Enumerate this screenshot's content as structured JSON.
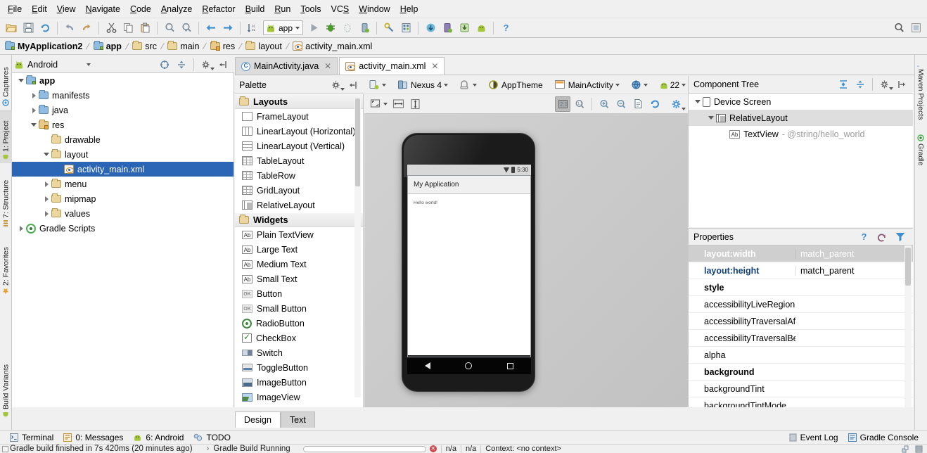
{
  "menu": {
    "items": [
      {
        "label": "File",
        "accel": "F"
      },
      {
        "label": "Edit",
        "accel": "E"
      },
      {
        "label": "View",
        "accel": "V"
      },
      {
        "label": "Navigate",
        "accel": "N"
      },
      {
        "label": "Code",
        "accel": "C"
      },
      {
        "label": "Analyze",
        "accel": "A"
      },
      {
        "label": "Refactor",
        "accel": "R"
      },
      {
        "label": "Build",
        "accel": "B"
      },
      {
        "label": "Run",
        "accel": "R"
      },
      {
        "label": "Tools",
        "accel": "T"
      },
      {
        "label": "VCS",
        "accel": "S"
      },
      {
        "label": "Window",
        "accel": "W"
      },
      {
        "label": "Help",
        "accel": "H"
      }
    ]
  },
  "toolbar": {
    "run_config": "app",
    "icons": [
      "open-folder-icon",
      "save-all-icon",
      "sync-icon",
      "undo-icon",
      "redo-icon",
      "cut-icon",
      "copy-icon",
      "paste-icon",
      "find-icon",
      "replace-icon",
      "back-icon",
      "forward-icon",
      "sort-icon"
    ],
    "right_icons": [
      "search-everywhere-icon",
      "layout-toggle-icon"
    ]
  },
  "breadcrumb": {
    "items": [
      {
        "label": "MyApplication2",
        "icon": "project-icon",
        "bold": true
      },
      {
        "label": "app",
        "icon": "module-icon",
        "bold": true
      },
      {
        "label": "src",
        "icon": "folder-icon",
        "bold": false
      },
      {
        "label": "main",
        "icon": "folder-icon",
        "bold": false
      },
      {
        "label": "res",
        "icon": "res-folder-icon",
        "bold": false
      },
      {
        "label": "layout",
        "icon": "folder-icon",
        "bold": false
      },
      {
        "label": "activity_main.xml",
        "icon": "xml-layout-icon",
        "bold": false
      }
    ]
  },
  "left_strip": {
    "tabs": [
      {
        "label": "Captures",
        "icon": "captures-icon"
      },
      {
        "label": "1: Project",
        "icon": "project-icon",
        "selected": true
      },
      {
        "label": "7: Structure",
        "icon": "structure-icon"
      },
      {
        "label": "2: Favorites",
        "icon": "favorites-icon"
      },
      {
        "label": "Build Variants",
        "icon": "build-variants-icon"
      }
    ]
  },
  "right_strip": {
    "tabs": [
      {
        "label": "Maven Projects",
        "icon": "maven-icon"
      },
      {
        "label": "Gradle",
        "icon": "gradle-icon"
      }
    ]
  },
  "project": {
    "view_selector": "Android",
    "tools": [
      "target-icon",
      "collapse-all-icon",
      "settings-icon",
      "hide-icon"
    ],
    "tree": [
      {
        "label": "app",
        "depth": 0,
        "twisty": "down",
        "icon": "module-folder-icon",
        "bold": true,
        "selected": false
      },
      {
        "label": "manifests",
        "depth": 1,
        "twisty": "right",
        "icon": "folder-icon",
        "bold": false,
        "selected": false
      },
      {
        "label": "java",
        "depth": 1,
        "twisty": "right",
        "icon": "folder-icon",
        "bold": false,
        "selected": false
      },
      {
        "label": "res",
        "depth": 1,
        "twisty": "down",
        "icon": "res-folder-icon",
        "bold": false,
        "selected": false
      },
      {
        "label": "drawable",
        "depth": 2,
        "twisty": "none",
        "icon": "tan-folder-icon",
        "bold": false,
        "selected": false
      },
      {
        "label": "layout",
        "depth": 2,
        "twisty": "down",
        "icon": "tan-folder-icon",
        "bold": false,
        "selected": false
      },
      {
        "label": "activity_main.xml",
        "depth": 3,
        "twisty": "none",
        "icon": "xml-layout-icon",
        "bold": false,
        "selected": true
      },
      {
        "label": "menu",
        "depth": 2,
        "twisty": "right",
        "icon": "tan-folder-icon",
        "bold": false,
        "selected": false
      },
      {
        "label": "mipmap",
        "depth": 2,
        "twisty": "right",
        "icon": "tan-folder-icon",
        "bold": false,
        "selected": false
      },
      {
        "label": "values",
        "depth": 2,
        "twisty": "right",
        "icon": "tan-folder-icon",
        "bold": false,
        "selected": false
      },
      {
        "label": "Gradle Scripts",
        "depth": 0,
        "twisty": "right",
        "icon": "gradle-icon",
        "bold": false,
        "selected": false
      }
    ]
  },
  "palette": {
    "title": "Palette",
    "tools": [
      "settings-icon",
      "hide-icon"
    ],
    "groups": [
      {
        "name": "Layouts",
        "items": [
          {
            "label": "FrameLayout",
            "icon": "frame-layout-icon"
          },
          {
            "label": "LinearLayout (Horizontal)",
            "icon": "linear-layout-horizontal-icon"
          },
          {
            "label": "LinearLayout (Vertical)",
            "icon": "linear-layout-vertical-icon"
          },
          {
            "label": "TableLayout",
            "icon": "table-layout-icon"
          },
          {
            "label": "TableRow",
            "icon": "table-row-icon"
          },
          {
            "label": "GridLayout",
            "icon": "grid-layout-icon"
          },
          {
            "label": "RelativeLayout",
            "icon": "relative-layout-icon"
          }
        ]
      },
      {
        "name": "Widgets",
        "items": [
          {
            "label": "Plain TextView",
            "icon": "textview-icon"
          },
          {
            "label": "Large Text",
            "icon": "textview-icon"
          },
          {
            "label": "Medium Text",
            "icon": "textview-icon"
          },
          {
            "label": "Small Text",
            "icon": "textview-icon"
          },
          {
            "label": "Button",
            "icon": "button-icon"
          },
          {
            "label": "Small Button",
            "icon": "button-icon"
          },
          {
            "label": "RadioButton",
            "icon": "radiobutton-icon"
          },
          {
            "label": "CheckBox",
            "icon": "checkbox-icon"
          },
          {
            "label": "Switch",
            "icon": "switch-icon"
          },
          {
            "label": "ToggleButton",
            "icon": "togglebutton-icon"
          },
          {
            "label": "ImageButton",
            "icon": "imagebutton-icon"
          },
          {
            "label": "ImageView",
            "icon": "imageview-icon"
          }
        ]
      }
    ]
  },
  "editor": {
    "tabs": [
      {
        "label": "MainActivity.java",
        "icon": "java-class-icon",
        "active": false
      },
      {
        "label": "activity_main.xml",
        "icon": "xml-layout-icon",
        "active": true
      }
    ],
    "toolbar": {
      "device_config": "device-config-icon",
      "device": "Nexus 4",
      "orientation": "orientation-icon",
      "theme": "AppTheme",
      "activity": "MainActivity",
      "locale": "locale-globe-icon",
      "api_level": "22"
    },
    "toolbar2": {
      "icons": [
        "fit-to-screen-icon",
        "width-icon",
        "height-icon",
        "zoom-actual-icon",
        "zoom-fit-icon",
        "zoom-in-icon",
        "zoom-out-icon",
        "preview-icon",
        "refresh-icon",
        "settings-icon"
      ]
    },
    "bottom_tabs": [
      {
        "label": "Design",
        "active": true
      },
      {
        "label": "Text",
        "active": false
      }
    ]
  },
  "preview": {
    "status_time": "5:30",
    "app_title": "My Application",
    "body_text": "Hello world!",
    "nav_buttons": [
      "back-icon",
      "home-icon",
      "recents-icon"
    ]
  },
  "component_tree": {
    "title": "Component Tree",
    "tools": [
      "expand-all-icon",
      "collapse-all-icon",
      "settings-icon",
      "hide-icon"
    ],
    "nodes": [
      {
        "label": "Device Screen",
        "detail": "",
        "depth": 0,
        "twisty": "down",
        "icon": "device-screen-icon",
        "highlight": false
      },
      {
        "label": "RelativeLayout",
        "detail": "",
        "depth": 1,
        "twisty": "down",
        "icon": "relative-layout-icon",
        "highlight": true
      },
      {
        "label": "TextView",
        "detail": "- @string/hello_world",
        "depth": 2,
        "twisty": "none",
        "icon": "textview-icon",
        "highlight": false
      }
    ]
  },
  "properties": {
    "title": "Properties",
    "tools": [
      "help-icon",
      "restore-icon",
      "filter-icon"
    ],
    "rows": [
      {
        "key": "layout:width",
        "value": "match_parent",
        "style": "selected"
      },
      {
        "key": "layout:height",
        "value": "match_parent",
        "style": "blue"
      },
      {
        "key": "style",
        "value": "",
        "style": "bold"
      },
      {
        "key": "accessibilityLiveRegion",
        "value": "",
        "style": "normal"
      },
      {
        "key": "accessibilityTraversalAf",
        "value": "",
        "style": "normal"
      },
      {
        "key": "accessibilityTraversalBe",
        "value": "",
        "style": "normal"
      },
      {
        "key": "alpha",
        "value": "",
        "style": "normal"
      },
      {
        "key": "background",
        "value": "",
        "style": "bold"
      },
      {
        "key": "backgroundTint",
        "value": "",
        "style": "normal"
      },
      {
        "key": "backgroundTintMode",
        "value": "",
        "style": "normal"
      }
    ]
  },
  "status": {
    "tools": [
      {
        "label": "Terminal",
        "icon": "terminal-icon",
        "accel": ""
      },
      {
        "label": "0: Messages",
        "icon": "messages-icon",
        "accel": "0"
      },
      {
        "label": "6: Android",
        "icon": "android-icon",
        "accel": "6"
      },
      {
        "label": "TODO",
        "icon": "todo-icon",
        "accel": ""
      }
    ],
    "right_tools": [
      {
        "label": "Event Log",
        "icon": "event-log-icon"
      },
      {
        "label": "Gradle Console",
        "icon": "gradle-console-icon"
      }
    ]
  },
  "bottom_bar": {
    "message": "Gradle build finished in 7s 420ms (20 minutes ago)",
    "task": "Gradle Build Running",
    "line_col": "n/a",
    "encoding": "n/a",
    "context": "Context: <no context>"
  },
  "colors": {
    "accent": "#2b65b5",
    "selection": "#2b65b5",
    "panel_bg": "#f0f0f0",
    "canvas_bg": "#c9c9c9",
    "error": "#cf4b4b"
  }
}
